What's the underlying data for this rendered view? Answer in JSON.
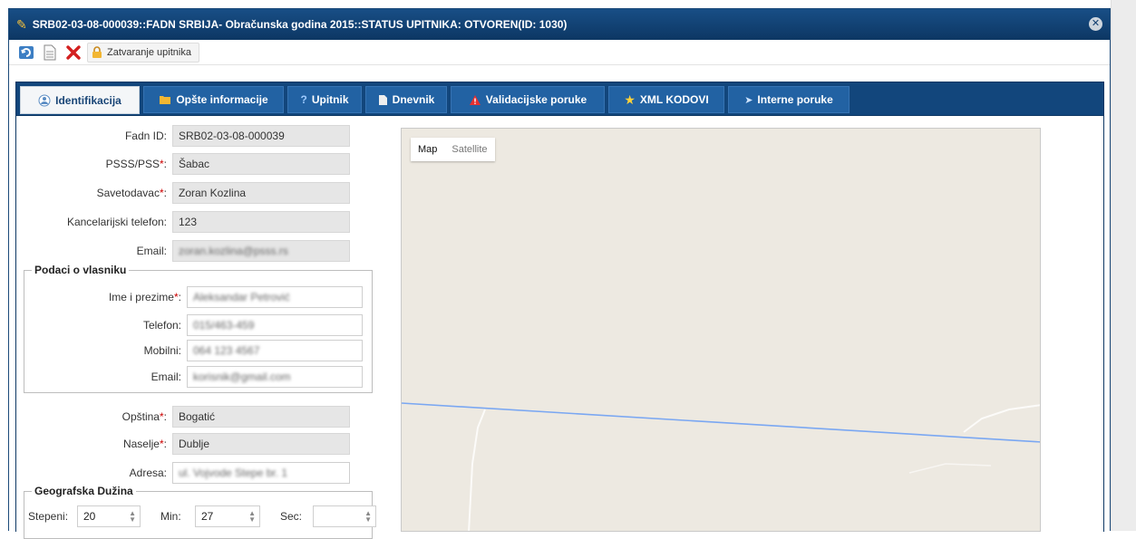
{
  "window": {
    "title": "SRB02-03-08-000039::FADN SRBIJA- Obračunska godina 2015::STATUS UPITNIKA: OTVOREN(ID: 1030)"
  },
  "toolbar": {
    "close_questionnaire_label": "Zatvaranje upitnika"
  },
  "tabs": [
    {
      "label": "Identifikacija",
      "icon": "people-icon",
      "active": true
    },
    {
      "label": "Opšte informacije",
      "icon": "folder-icon",
      "active": false
    },
    {
      "label": "Upitnik",
      "icon": "question-icon",
      "active": false
    },
    {
      "label": "Dnevnik",
      "icon": "document-icon",
      "active": false
    },
    {
      "label": "Validacijske poruke",
      "icon": "warning-icon",
      "active": false
    },
    {
      "label": "XML KODOVI",
      "icon": "star-icon",
      "active": false
    },
    {
      "label": "Interne poruke",
      "icon": "message-icon",
      "active": false
    }
  ],
  "form": {
    "fadn_id": {
      "label": "Fadn ID:",
      "value": "SRB02-03-08-000039"
    },
    "psss": {
      "label": "PSSS/PSS",
      "value": "Šabac"
    },
    "savetodavac": {
      "label": "Savetodavac",
      "value": "Zoran Kozlina"
    },
    "kancelarijski_telefon": {
      "label": "Kancelarijski telefon:",
      "value": "123"
    },
    "email": {
      "label": "Email:",
      "value": "zoran.kozlina@psss.rs"
    },
    "owner": {
      "legend": "Podaci o vlasniku",
      "ime_prezime": {
        "label": "Ime i prezime",
        "value": "Aleksandar Petrović"
      },
      "telefon": {
        "label": "Telefon:",
        "value": "015/463-459"
      },
      "mobilni": {
        "label": "Mobilni:",
        "value": "064 123 4567"
      },
      "email": {
        "label": "Email:",
        "value": "korisnik@gmail.com"
      }
    },
    "opstina": {
      "label": "Opština",
      "value": "Bogatić"
    },
    "naselje": {
      "label": "Naselje",
      "value": "Dublje"
    },
    "adresa": {
      "label": "Adresa:",
      "value": "ul. Vojvode Stepe br. 1"
    },
    "geo": {
      "legend": "Geografska Dužina",
      "stepeni": {
        "label": "Stepeni:",
        "value": "20"
      },
      "min": {
        "label": "Min:",
        "value": "27"
      },
      "sec": {
        "label": "Sec:",
        "value": ""
      }
    },
    "required_mark": "*",
    "colon": ":"
  },
  "map": {
    "type_map": "Map",
    "type_satellite": "Satellite"
  },
  "colors": {
    "titlebar": "#0f3d6e",
    "tab_bg": "#2262a3",
    "required": "#cc0000",
    "map_bg": "#ede9e1",
    "road": "#6f9ef0"
  }
}
